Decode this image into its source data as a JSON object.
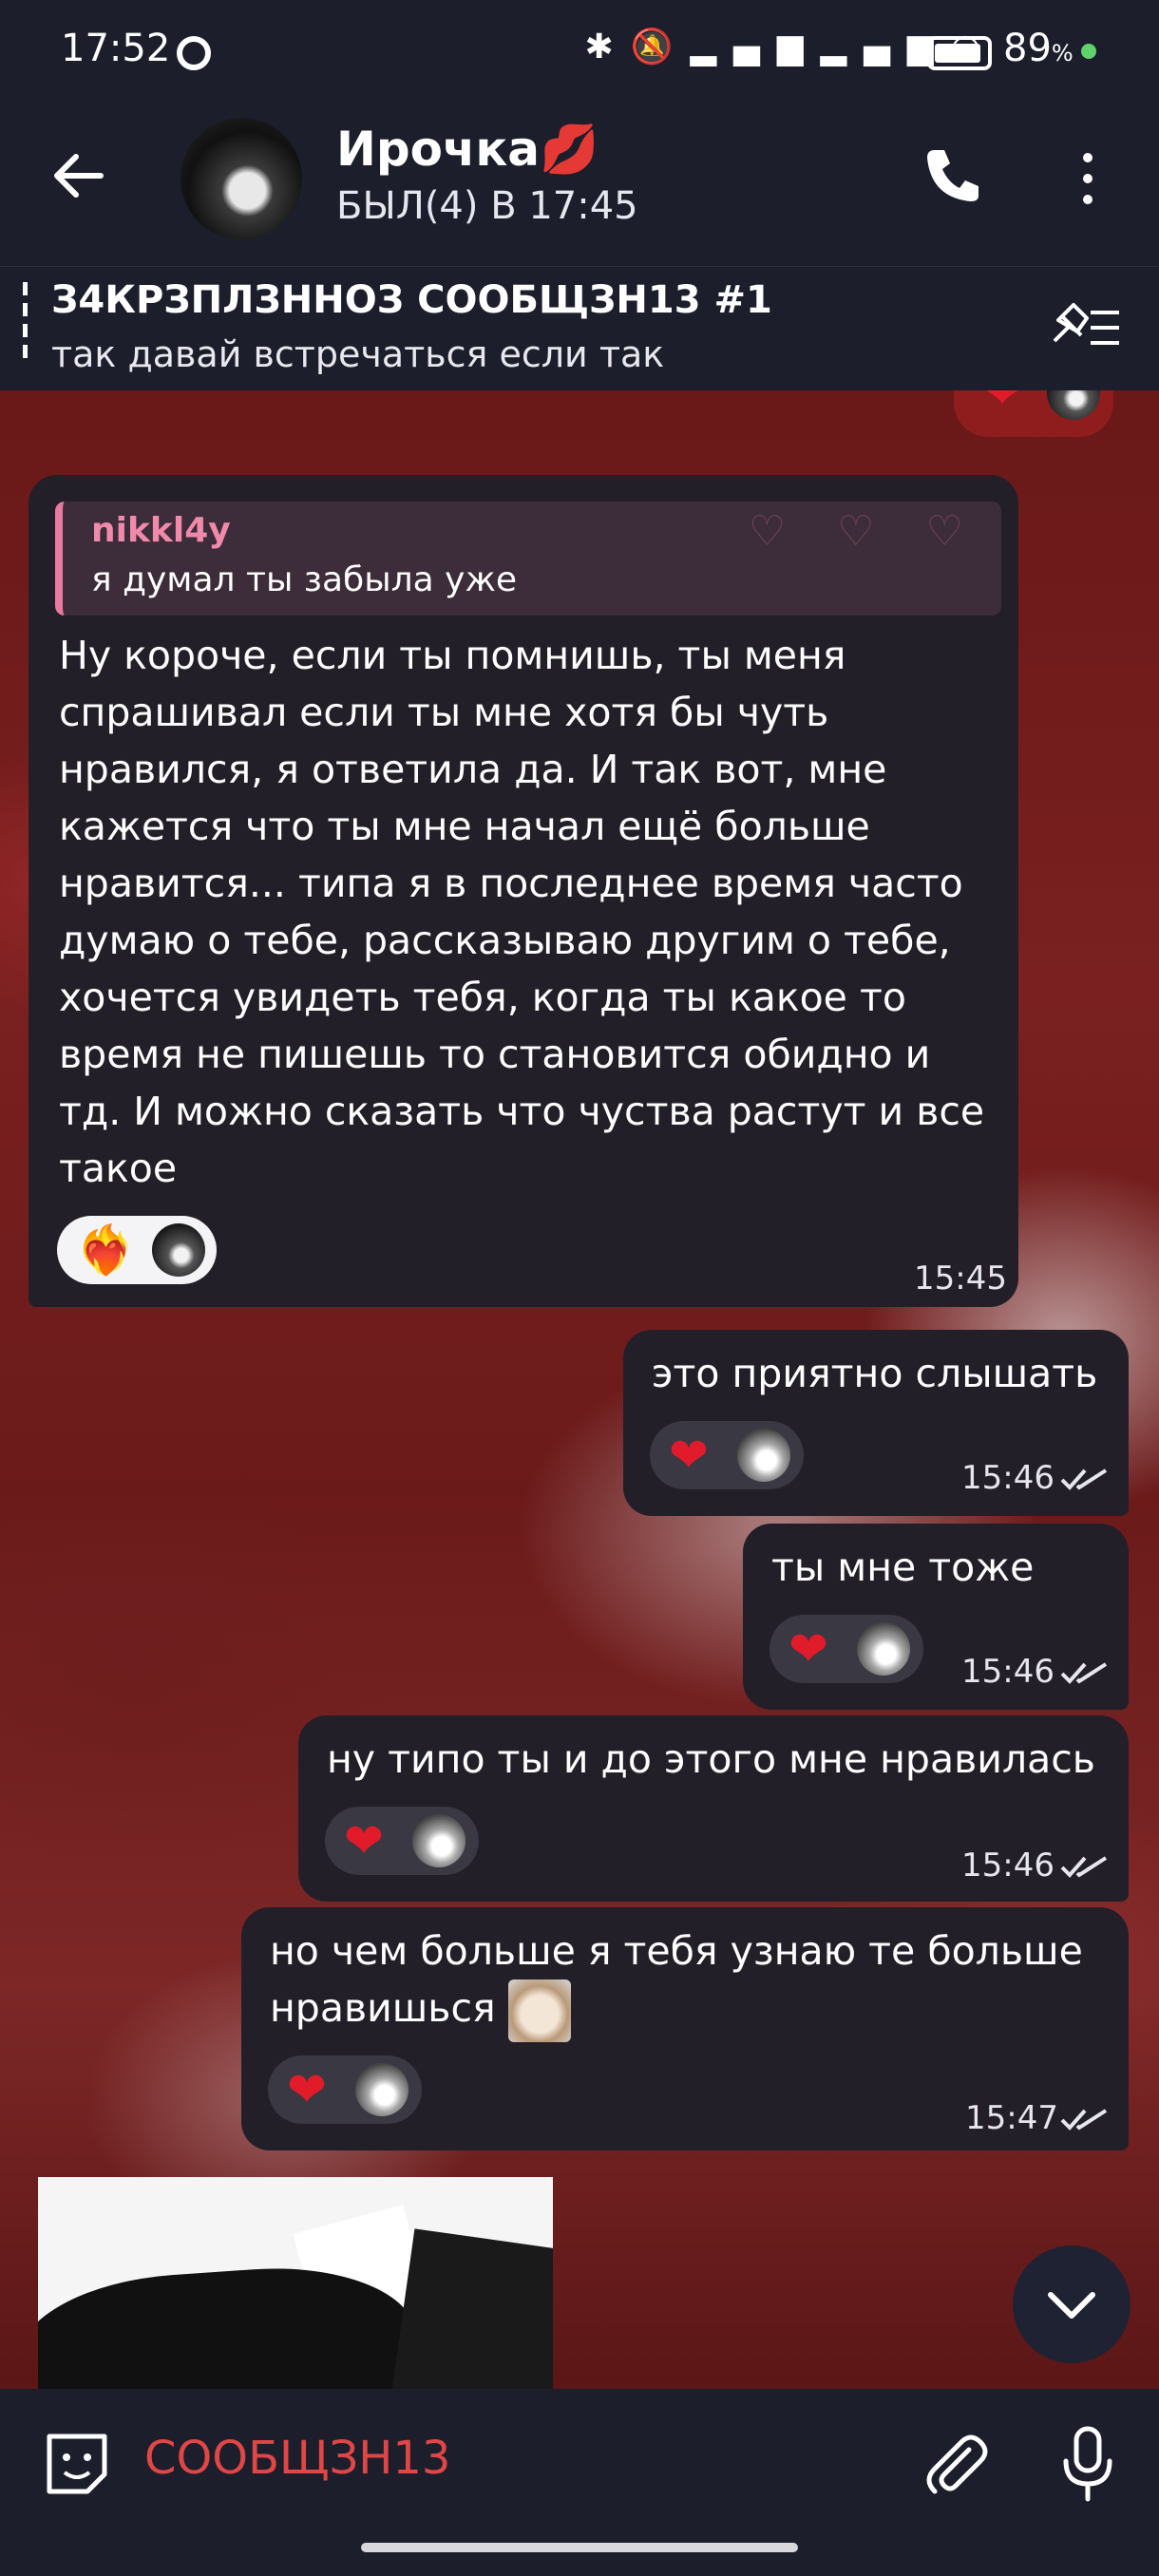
{
  "status_bar": {
    "time": "17:52",
    "battery_pct": "89",
    "battery_unit": "%",
    "icons": [
      "bluetooth-icon",
      "mute-icon",
      "signal-icon",
      "signal-icon",
      "wifi-icon"
    ]
  },
  "header": {
    "name": "Ирочка💋",
    "last_seen": "БЫЛ(4) В 17:45"
  },
  "pinned": {
    "title": "З4КРЗПЛЗННОЗ СООБЩЗН13 #1",
    "text": "так давай встречаться если так"
  },
  "messages": [
    {
      "direction": "in",
      "reply_author": "nikkl4y",
      "reply_text": "я думал ты забыла уже",
      "text": "Ну короче, если ты помнишь, ты меня спрашивал если ты мне хотя бы чуть нравился, я ответила да. И так вот, мне кажется что ты мне начал ещё больше нравится... типа я в последнее время часто думаю о тебе, рассказываю другим о тебе, хочется увидеть тебя, когда ты какое то время не пишешь то становится обидно и тд. И можно сказать что чуства растут и все такое",
      "reaction": "❤️‍🔥",
      "time": "15:45"
    },
    {
      "direction": "out",
      "text": "это приятно слышать",
      "reaction": "❤",
      "time": "15:46"
    },
    {
      "direction": "out",
      "text": "ты мне тоже",
      "reaction": "❤",
      "time": "15:46"
    },
    {
      "direction": "out",
      "text": "ну типо ты и до этого мне нравилась",
      "reaction": "❤",
      "time": "15:46"
    },
    {
      "direction": "out",
      "text": "но чем больше я тебя узнаю те больше нравишься",
      "reaction": "❤",
      "time": "15:47"
    }
  ],
  "top_reaction": "❤",
  "input": {
    "placeholder": "СООБЩЗН13"
  },
  "colors": {
    "header_bg": "#1c1f2b",
    "bubble_bg": "#231f29",
    "accent_red": "#e04646",
    "reply_accent": "#f08aaa",
    "heart": "#e21b2a"
  }
}
